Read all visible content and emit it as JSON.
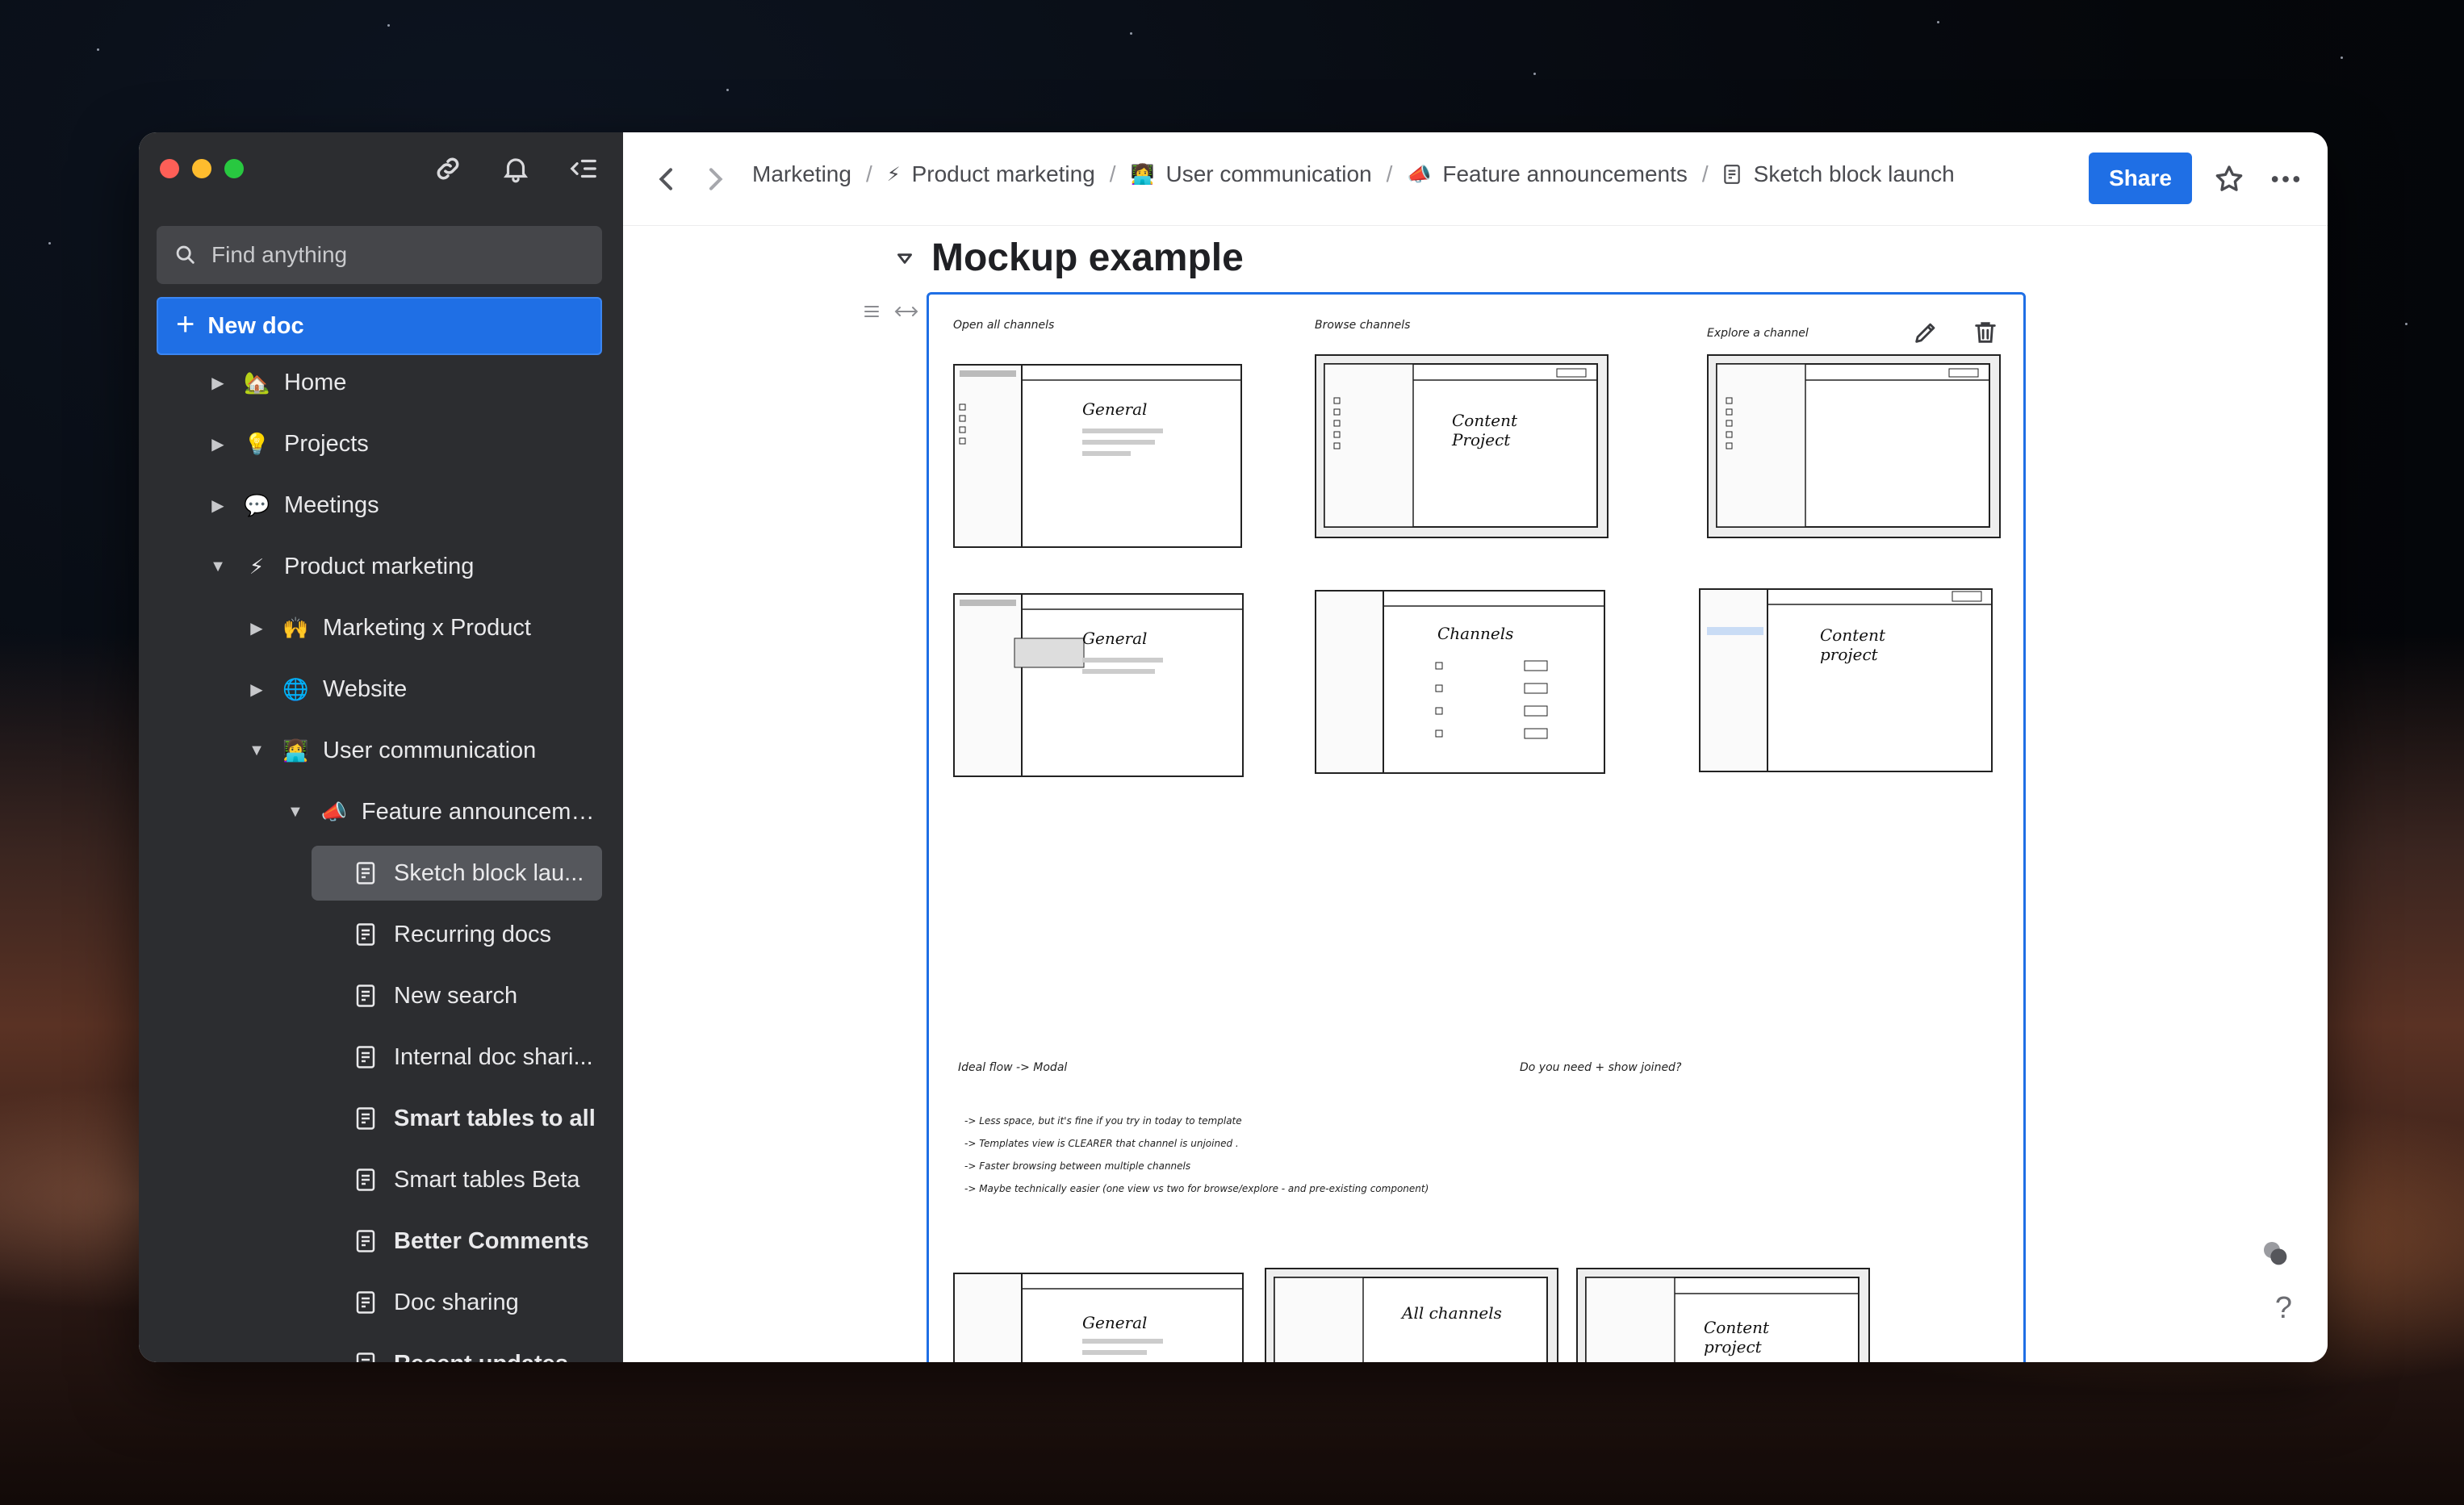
{
  "sidebar": {
    "search_placeholder": "Find anything",
    "new_doc_label": "New doc",
    "items": [
      {
        "label": "Home",
        "emoji": "🏡"
      },
      {
        "label": "Projects",
        "emoji": "💡"
      },
      {
        "label": "Meetings",
        "emoji": "💬"
      },
      {
        "label": "Product marketing",
        "emoji": "⚡"
      },
      {
        "label": "Marketing x Product",
        "emoji": "🙌"
      },
      {
        "label": "Website",
        "emoji": "🌐"
      },
      {
        "label": "User communication",
        "emoji": "👩‍💻"
      },
      {
        "label": "Feature announceme...",
        "emoji": "📣"
      },
      {
        "label": "Sketch block lau..."
      },
      {
        "label": "Recurring docs"
      },
      {
        "label": "New search"
      },
      {
        "label": "Internal doc shari..."
      },
      {
        "label": "Smart tables to all"
      },
      {
        "label": "Smart tables Beta"
      },
      {
        "label": "Better Comments"
      },
      {
        "label": "Doc sharing"
      },
      {
        "label": "Recent updates"
      }
    ]
  },
  "breadcrumbs": [
    {
      "label": "Marketing"
    },
    {
      "label": "Product marketing",
      "emoji": "⚡"
    },
    {
      "label": "User communication",
      "emoji": "👩‍💻"
    },
    {
      "label": "Feature announcements",
      "emoji": "📣"
    },
    {
      "label": "Sketch block launch"
    }
  ],
  "toolbar": {
    "share_label": "Share"
  },
  "doc": {
    "heading": "Mockup example",
    "sketch": {
      "labels": {
        "open_all": "Open all channels",
        "browse": "Browse channels",
        "explore": "Explore a channel",
        "ideal_flow": "Ideal flow -> Modal",
        "do_you_need": "Do you need + show joined?"
      },
      "frames": {
        "general": "General",
        "content_project": "Content Project",
        "channels": "Channels",
        "content_project_lower": "Content project",
        "all_channels": "All channels"
      },
      "notes": [
        "-> Less space, but it's fine if you try in today to template",
        "-> Templates view is CLEARER that channel is unjoined .",
        "-> Faster browsing between multiple channels",
        "-> Maybe technically easier (one view vs two for browse/explore - and pre-existing component)"
      ]
    }
  },
  "help_label": "?"
}
